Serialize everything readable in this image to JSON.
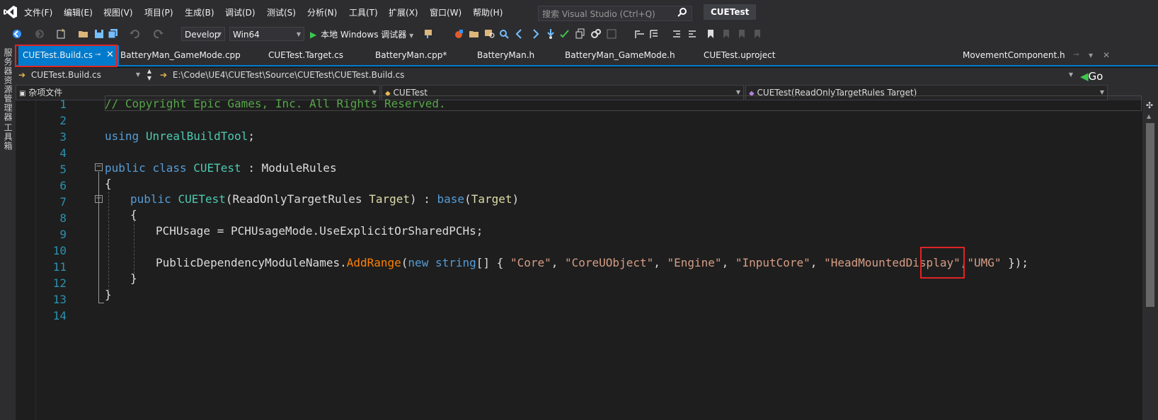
{
  "menubar": {
    "items": [
      "文件(F)",
      "编辑(E)",
      "视图(V)",
      "项目(P)",
      "生成(B)",
      "调试(D)",
      "测试(S)",
      "分析(N)",
      "工具(T)",
      "扩展(X)",
      "窗口(W)",
      "帮助(H)"
    ],
    "search_placeholder": "搜索 Visual Studio (Ctrl+Q)",
    "project_title": "CUETest"
  },
  "toolbar": {
    "config": "Develop",
    "platform": "Win64",
    "run_label": "本地 Windows 调试器"
  },
  "siderail": {
    "items": [
      "服务器资源管理器",
      "工具箱"
    ]
  },
  "tabs": [
    {
      "label": "CUETest.Build.cs",
      "active": true
    },
    {
      "label": "BatteryMan_GameMode.cpp"
    },
    {
      "label": "CUETest.Target.cs"
    },
    {
      "label": "BatteryMan.cpp*"
    },
    {
      "label": "BatteryMan.h"
    },
    {
      "label": "BatteryMan_GameMode.h"
    },
    {
      "label": "CUETest.uproject"
    },
    {
      "label": "MovementComponent.h"
    }
  ],
  "navbar": {
    "file": "CUETest.Build.cs",
    "path": "E:\\Code\\UE4\\CUETest\\Source\\CUETest\\CUETest.Build.cs",
    "go": "Go",
    "scope": "杂项文件",
    "class": "CUETest",
    "member": "CUETest(ReadOnlyTargetRules Target)"
  },
  "code": {
    "line_numbers": [
      "1",
      "2",
      "3",
      "4",
      "5",
      "6",
      "7",
      "8",
      "9",
      "10",
      "11",
      "12",
      "13",
      "14"
    ],
    "comment": "// Copyright Epic Games, Inc. All Rights Reserved.",
    "using_kw": "using",
    "using_ns": "UnrealBuildTool",
    "semicolon": ";",
    "public_kw": "public",
    "class_kw": "class",
    "class_name": "CUETest",
    "colon": ":",
    "base_class": "ModuleRules",
    "open_brace": "{",
    "close_brace": "}",
    "ctor_name": "CUETest",
    "param_type": "ReadOnlyTargetRules",
    "param_name": "Target",
    "base_kw": "base",
    "base_arg": "Target",
    "pch_line": "PCHUsage = PCHUsageMode.UseExplicitOrSharedPCHs;",
    "deps_obj": "PublicDependencyModuleNames.",
    "add_range": "AddRange",
    "new_kw": "new",
    "string_kw": "string",
    "array_open": "[] { ",
    "modules": [
      "\"Core\"",
      "\"CoreUObject\"",
      "\"Engine\"",
      "\"InputCore\"",
      "\"HeadMountedDisplay\""
    ],
    "highlight_module": "\"UMG\"",
    "line11_end": " });"
  },
  "colors": {
    "accent": "#007acc",
    "highlight_box": "#e02424"
  }
}
